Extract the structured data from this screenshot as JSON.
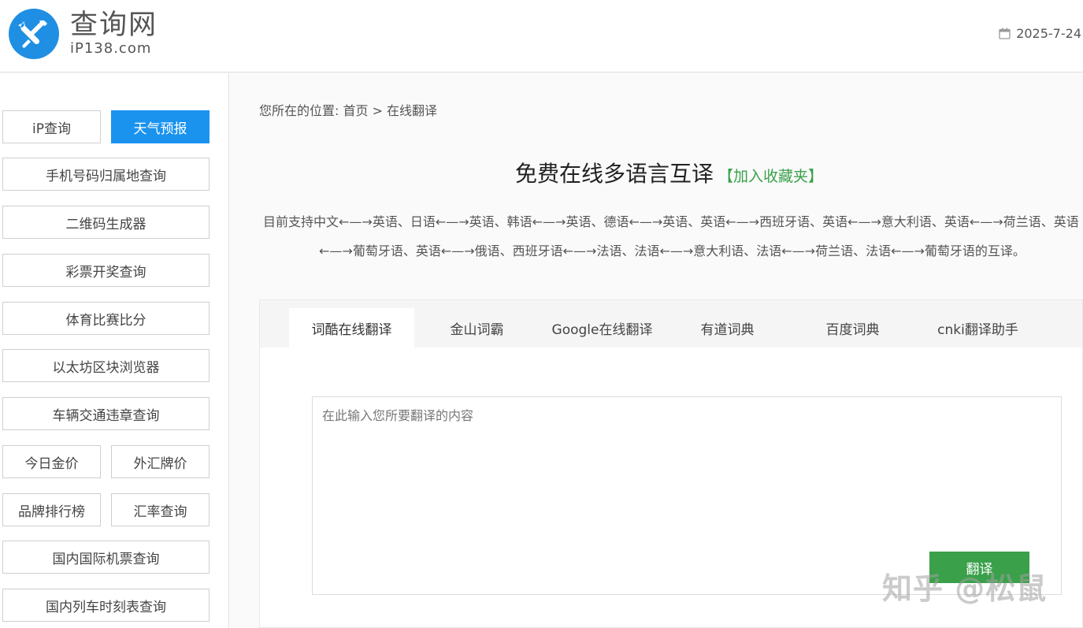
{
  "header": {
    "logo_name": "查询网",
    "logo_domain": "iP138.com",
    "date": "2025-7-24",
    "logo_icon": "wrench-screwdriver-icon",
    "calendar_icon": "calendar-icon"
  },
  "sidebar": {
    "ip_query": "iP查询",
    "weather": "天气预报",
    "phone_location": "手机号码归属地查询",
    "qrcode": "二维码生成器",
    "lottery": "彩票开奖查询",
    "sports": "体育比赛比分",
    "ethereum": "以太坊区块浏览器",
    "traffic": "车辆交通违章查询",
    "gold": "今日金价",
    "forex": "外汇牌价",
    "brand": "品牌排行榜",
    "exchange": "汇率查询",
    "flights": "国内国际机票查询",
    "trains": "国内列车时刻表查询"
  },
  "main": {
    "breadcrumb": "您所在的位置: 首页 > 在线翻译",
    "title": "免费在线多语言互译",
    "favorite": "【加入收藏夹】",
    "support_line1": "目前支持中文←—→英语、日语←—→英语、韩语←—→英语、德语←—→英语、英语←—→西班牙语、英语←—→意大利语、英语←—→荷兰语、英语",
    "support_line2": "←—→葡萄牙语、英语←—→俄语、西班牙语←—→法语、法语←—→意大利语、法语←—→荷兰语、法语←—→葡萄牙语的互译。",
    "tabs": [
      "词酷在线翻译",
      "金山词霸",
      "Google在线翻译",
      "有道词典",
      "百度词典",
      "cnki翻译助手"
    ],
    "input_placeholder": "在此输入您所要翻译的内容",
    "translate_button": "翻译"
  },
  "watermark": "知乎 @松鼠",
  "colors": {
    "accent_blue": "#1a93ef",
    "accent_green": "#3aa04a"
  }
}
